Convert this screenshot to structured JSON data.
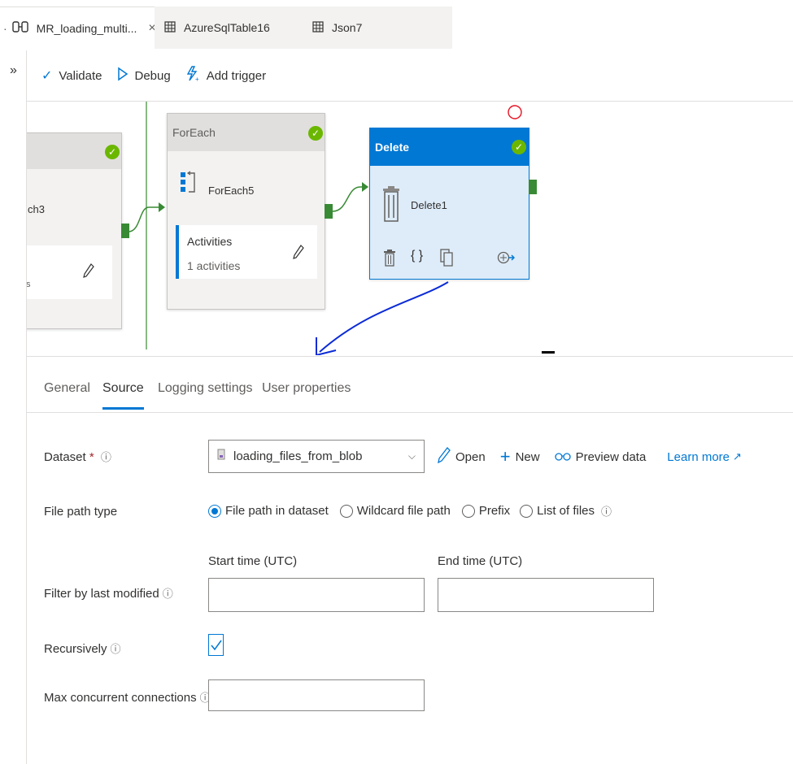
{
  "tabs": [
    {
      "label": "MR_loading_multi...",
      "icon": "pipeline-icon",
      "close": "×"
    },
    {
      "label": "AzureSqlTable16",
      "icon": "table-icon"
    },
    {
      "label": "Json7",
      "icon": "table-icon"
    }
  ],
  "rail": {
    "collapse": "»"
  },
  "toolbar": {
    "validate": "Validate",
    "debug": "Debug",
    "add_trigger": "Add trigger"
  },
  "canvas": {
    "node_left_label": "ch3",
    "node_left_foot": "s",
    "foreach": {
      "header": "ForEach",
      "name": "ForEach5",
      "activities_title": "Activities",
      "activities_count": "1 activities"
    },
    "delete": {
      "header": "Delete",
      "name": "Delete1"
    }
  },
  "panel_tabs": [
    "General",
    "Source",
    "Logging settings",
    "User properties"
  ],
  "selected_tab": "Source",
  "form": {
    "dataset_label": "Dataset",
    "dataset_required": "*",
    "dataset_value": "loading_files_from_blob",
    "open": "Open",
    "new": "New",
    "preview": "Preview data",
    "learn_more": "Learn more",
    "file_path_type_label": "File path type",
    "file_path_options": [
      "File path in dataset",
      "Wildcard file path",
      "Prefix",
      "List of files"
    ],
    "file_path_selected": "File path in dataset",
    "start_time_label": "Start time (UTC)",
    "end_time_label": "End time (UTC)",
    "filter_label": "Filter by last modified",
    "recursively_label": "Recursively",
    "recursively_checked": true,
    "max_conn_label": "Max concurrent connections",
    "max_conn_value": ""
  },
  "colors": {
    "accent": "#0078d4",
    "success": "#6bb700",
    "port": "#388a34",
    "delete_header": "#0078d4",
    "delete_body": "#deecf9",
    "annotation": "#0b2bd6",
    "annotation_circle": "#e81123"
  }
}
